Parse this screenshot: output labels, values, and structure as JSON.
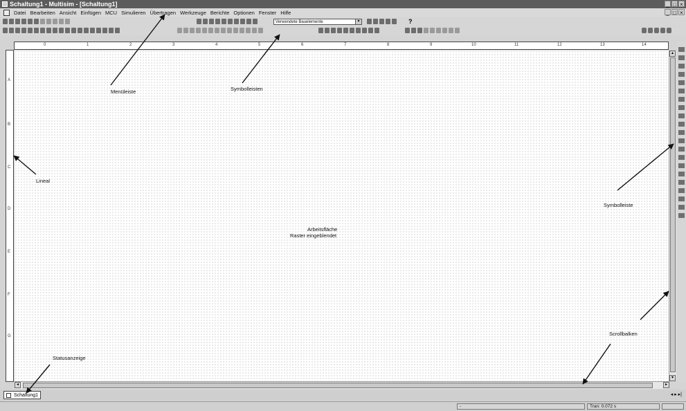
{
  "window": {
    "title": "Schaltung1 - Multisim - [Schaltung1]",
    "minimize": "_",
    "maximize": "□",
    "close": "×"
  },
  "menu": {
    "items": [
      "Datei",
      "Bearbeiten",
      "Ansicht",
      "Einfügen",
      "MCU",
      "Simulieren",
      "Übertragen",
      "Werkzeuge",
      "Berichte",
      "Optionen",
      "Fenster",
      "Hilfe"
    ]
  },
  "toolbar": {
    "component_select": "Verwendete Bauelemente",
    "dropdown_arrow": "▾",
    "help_glyph": "?"
  },
  "ruler": {
    "top_ticks": [
      "0",
      "1",
      "2",
      "3",
      "4",
      "5",
      "6",
      "7",
      "8",
      "9",
      "10",
      "11",
      "12",
      "13",
      "14"
    ],
    "left_ticks": [
      "A",
      "B",
      "C",
      "D",
      "E",
      "F",
      "G"
    ]
  },
  "annotations": {
    "menu_bar": "Menüleiste",
    "toolbars": "Symbolleisten",
    "ruler": "Lineal",
    "toolbar_right": "Symbolleiste",
    "workspace_line1": "Arbeitsfläche",
    "workspace_line2": "Raster eingeblendet",
    "scrollbars": "Scrollbalken",
    "status": "Statusanzeige"
  },
  "tabs": [
    {
      "label": "Schaltung1"
    }
  ],
  "status": {
    "left": "-",
    "tran": "Tran: 0.072 s"
  },
  "tab_nav": "◂ ▸ ▸|",
  "icons": [
    "app-icon",
    "document-icon",
    "new-icon",
    "open-icon",
    "save-icon",
    "print-icon",
    "cut-icon",
    "copy-icon",
    "paste-icon",
    "undo-icon",
    "redo-icon",
    "zoom-in-icon",
    "zoom-out-icon",
    "help-icon",
    "run-icon",
    "pause-icon",
    "stop-icon"
  ]
}
